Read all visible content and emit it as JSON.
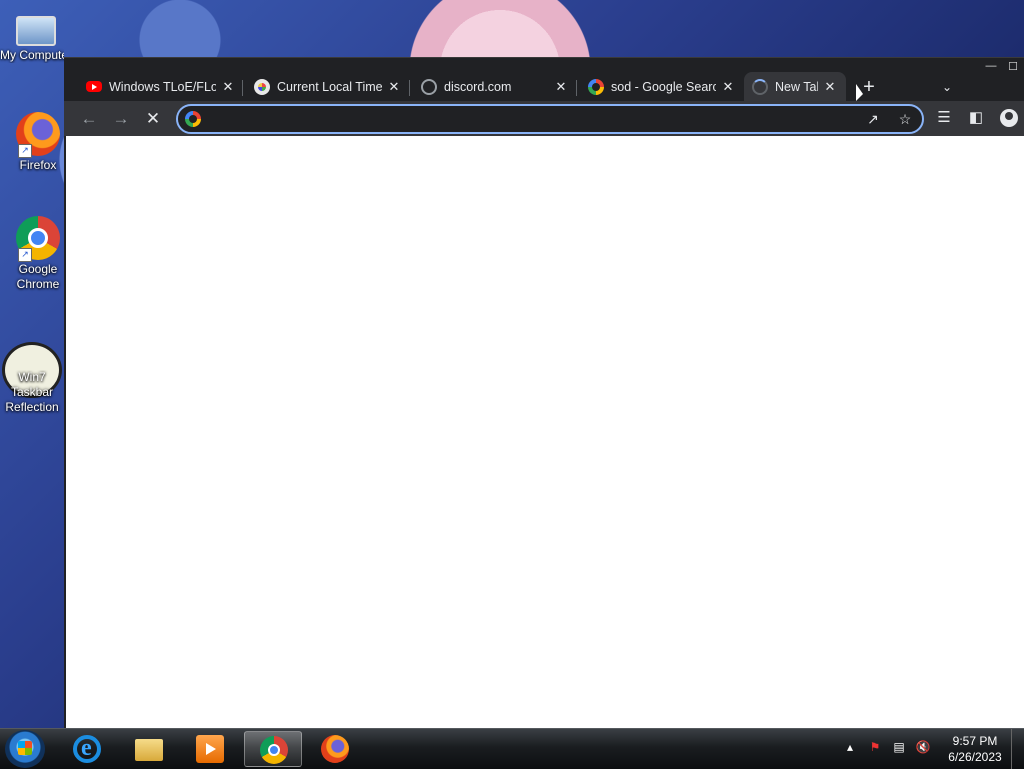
{
  "desktop": {
    "icons": [
      {
        "label": "My Computer",
        "icon": "computer-icon"
      },
      {
        "label": "Firefox",
        "icon": "firefox-icon"
      },
      {
        "label": "Google Chrome",
        "icon": "chrome-icon"
      },
      {
        "label": "Win7 Taskbar Reflection",
        "icon": "cat-app-icon"
      }
    ]
  },
  "browser": {
    "tabs": [
      {
        "title": "Windows TLoE/FLoE",
        "favicon": "youtube-icon"
      },
      {
        "title": "Current Local Time",
        "favicon": "timeanddate-icon"
      },
      {
        "title": "discord.com",
        "favicon": "globe-icon"
      },
      {
        "title": "sod - Google Search",
        "favicon": "google-icon"
      },
      {
        "title": "New Tab",
        "favicon": "loading-spinner-icon",
        "active": true
      }
    ],
    "new_tab_symbol": "+",
    "tab_close_symbol": "✕",
    "omnibox": {
      "value": "",
      "placeholder": ""
    },
    "caption": {
      "minimize": "—",
      "maximize": "☐"
    }
  },
  "taskbar": {
    "apps": [
      {
        "name": "Internet Explorer",
        "icon": "ie-icon"
      },
      {
        "name": "Windows Explorer",
        "icon": "folder-icon"
      },
      {
        "name": "Media Player",
        "icon": "media-player-icon"
      },
      {
        "name": "Google Chrome",
        "icon": "chrome-icon",
        "active": true
      },
      {
        "name": "Firefox",
        "icon": "firefox-icon"
      }
    ],
    "clock": {
      "time": "9:57 PM",
      "date": "6/26/2023"
    }
  }
}
